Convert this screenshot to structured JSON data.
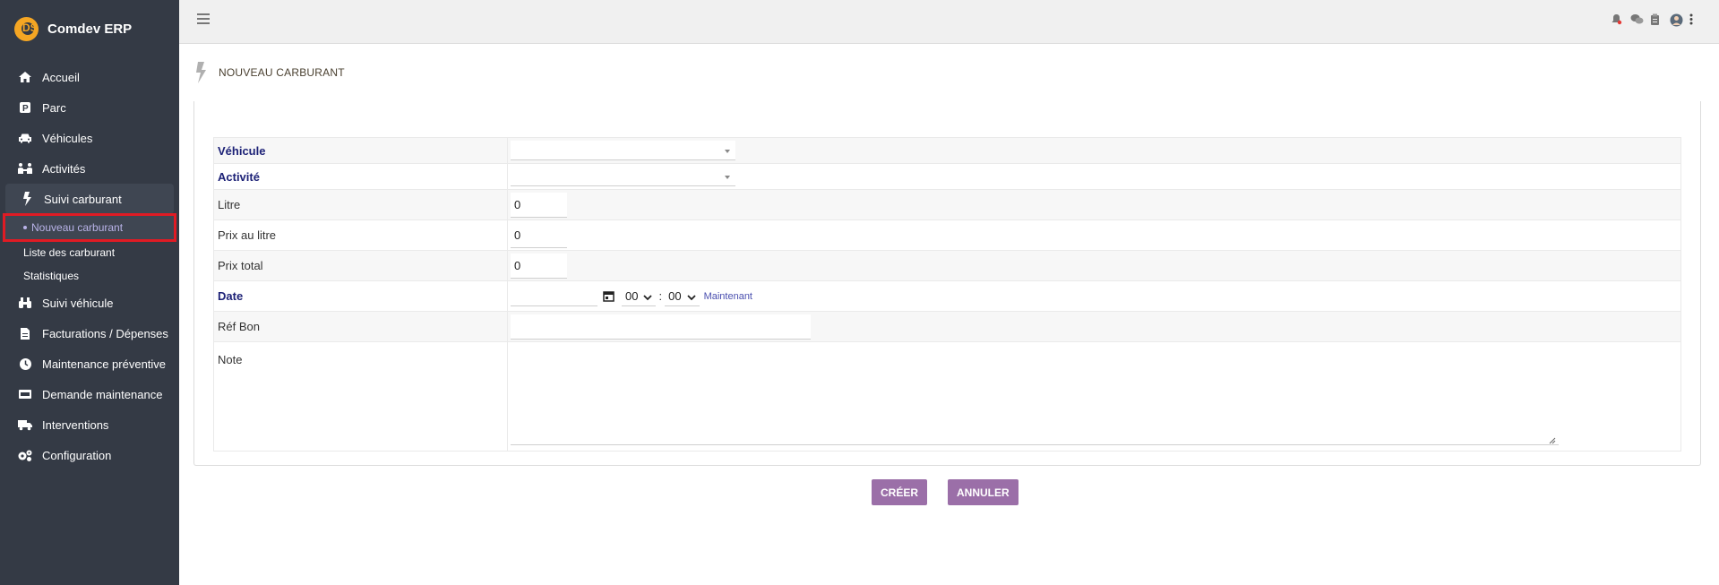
{
  "app": {
    "name": "Comdev ERP",
    "logo_letters": "DS"
  },
  "sidebar": {
    "items": [
      {
        "label": "Accueil",
        "icon": "home-icon"
      },
      {
        "label": "Parc",
        "icon": "parking-icon"
      },
      {
        "label": "Véhicules",
        "icon": "car-icon"
      },
      {
        "label": "Activités",
        "icon": "people-icon"
      },
      {
        "label": "Suivi carburant",
        "icon": "bolt-icon"
      },
      {
        "label": "Suivi véhicule",
        "icon": "binoculars-icon"
      },
      {
        "label": "Facturations / Dépenses",
        "icon": "invoice-icon"
      },
      {
        "label": "Maintenance préventive",
        "icon": "clock-icon"
      },
      {
        "label": "Demande maintenance",
        "icon": "ticket-icon"
      },
      {
        "label": "Interventions",
        "icon": "truck-icon"
      },
      {
        "label": "Configuration",
        "icon": "gears-icon"
      }
    ],
    "sub_items": [
      {
        "label": "Nouveau carburant",
        "current": true
      },
      {
        "label": "Liste des carburant"
      },
      {
        "label": "Statistiques"
      }
    ]
  },
  "topbar": {
    "icons": [
      "bell-icon",
      "chat-icon",
      "clipboard-icon",
      "avatar",
      "more-vertical-icon"
    ]
  },
  "page": {
    "title": "NOUVEAU CARBURANT"
  },
  "form": {
    "vehicule": {
      "label": "Véhicule",
      "value": ""
    },
    "activite": {
      "label": "Activité",
      "value": ""
    },
    "litre": {
      "label": "Litre",
      "value": "0"
    },
    "prix_litre": {
      "label": "Prix au litre",
      "value": "0"
    },
    "prix_total": {
      "label": "Prix total",
      "value": "0"
    },
    "date": {
      "label": "Date",
      "value": "",
      "hour": "00",
      "minute": "00",
      "now_label": "Maintenant"
    },
    "ref_bon": {
      "label": "Réf Bon",
      "value": ""
    },
    "note": {
      "label": "Note",
      "value": ""
    }
  },
  "actions": {
    "create": "CRÉER",
    "cancel": "ANNULER"
  },
  "colors": {
    "sidebar_bg": "#343a45",
    "button": "#9b6fa8",
    "required_label": "#1d2277",
    "highlight": "#e01b24"
  }
}
